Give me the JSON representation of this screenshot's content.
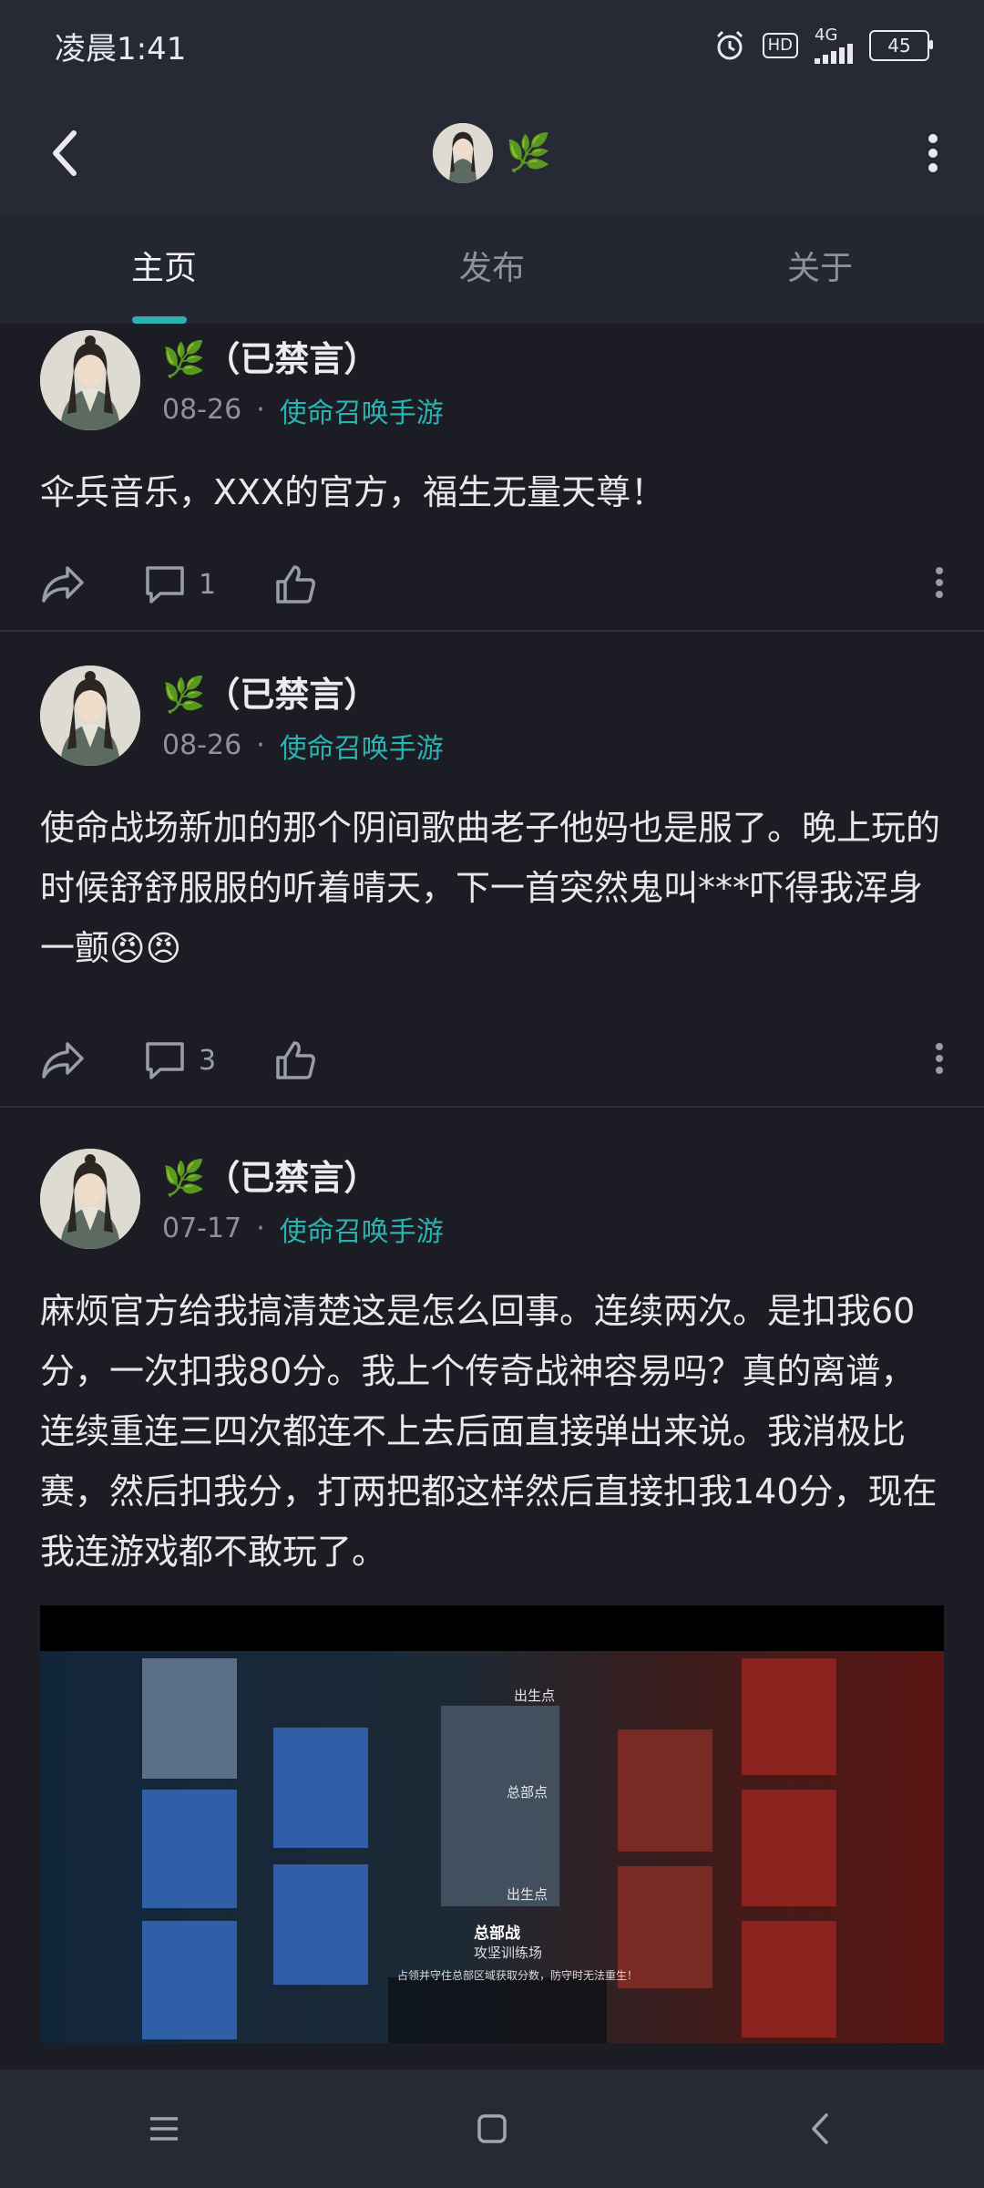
{
  "status_bar": {
    "time": "凌晨1:41",
    "network": "4G",
    "hd_label": "HD",
    "battery": "45"
  },
  "header": {
    "profile_badge": "🌿"
  },
  "tabs": [
    {
      "label": "主页"
    },
    {
      "label": "发布"
    },
    {
      "label": "关于"
    }
  ],
  "posts": [
    {
      "name": "🌿（已禁言）",
      "date": "08-26",
      "separator": "·",
      "game": "使命召唤手游",
      "text": "伞兵音乐，XXX的官方，福生无量天尊！",
      "comment_count": "1"
    },
    {
      "name": "🌿（已禁言）",
      "date": "08-26",
      "separator": "·",
      "game": "使命召唤手游",
      "text": "使命战场新加的那个阴间歌曲老子他妈也是服了。晚上玩的时候舒舒服服的听着晴天，下一首突然鬼叫***吓得我浑身一颤😠😠",
      "comment_count": "3"
    },
    {
      "name": "🌿（已禁言）",
      "date": "07-17",
      "separator": "·",
      "game": "使命召唤手游",
      "text": "麻烦官方给我搞清楚这是怎么回事。连续两次。是扣我60分，一次扣我80分。我上个传奇战神容易吗？真的离谱，连续重连三四次都连不上去后面直接弹出来说。我消极比赛，然后扣我分，打两把都这样然后直接扣我140分，现在我连游戏都不敢玩了。",
      "image": {
        "spawn_point_top": "出生点",
        "hq_point": "总部点",
        "spawn_point_bottom": "出生点",
        "mode_title": "总部战",
        "mode_map": "攻坚训练场",
        "mode_desc": "占领并守住总部区域获取分数，防守时无法重生！"
      }
    }
  ],
  "colors": {
    "accent": "#2ab3b0",
    "background": "#1b1c24",
    "bar": "#272a35"
  }
}
